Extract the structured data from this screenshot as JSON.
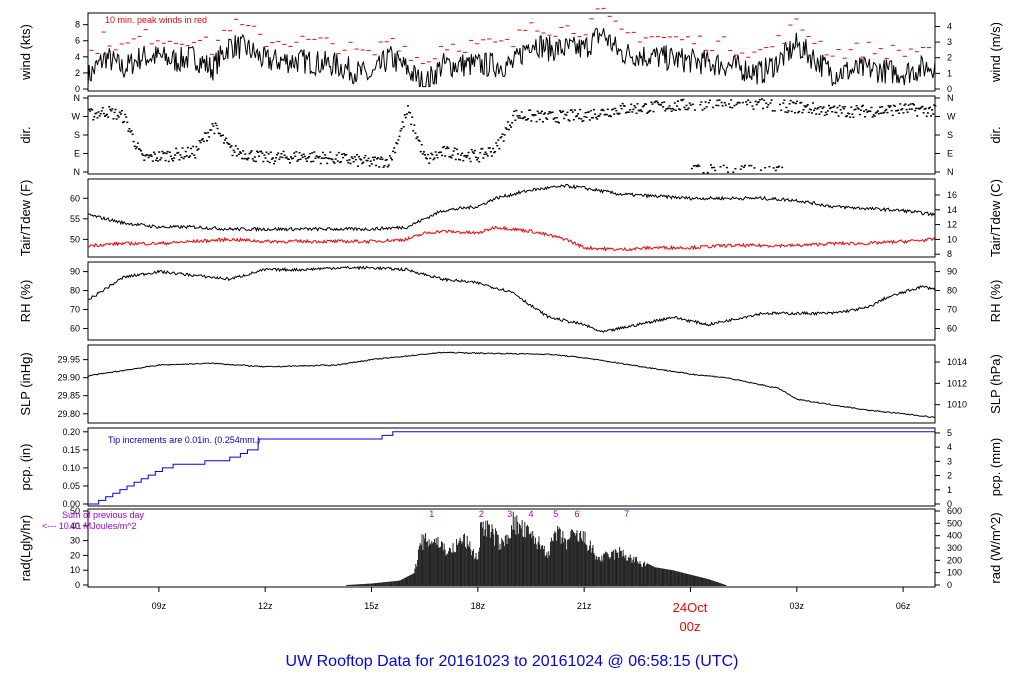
{
  "title": "UW Rooftop Data for 20161023  to  20161024 @ 06:58:15  (UTC)",
  "colors": {
    "title": "#0000ff",
    "peak": "#ff0000",
    "dew": "#ff0000",
    "pcp": "#0000ff",
    "annot": "#a000e0",
    "date": "#ff0000"
  },
  "x_axis": {
    "range_hours": [
      7.0,
      30.9
    ],
    "ticks": [
      {
        "h": 9,
        "label": "09z"
      },
      {
        "h": 12,
        "label": "12z"
      },
      {
        "h": 15,
        "label": "15z"
      },
      {
        "h": 18,
        "label": "18z"
      },
      {
        "h": 21,
        "label": "21z"
      },
      {
        "h": 27,
        "label": "03z"
      },
      {
        "h": 30,
        "label": "06z"
      }
    ],
    "date_label": "24Oct",
    "date_hour_label": "00z"
  },
  "chart_data": [
    {
      "type": "line",
      "name": "wind",
      "ylabel": "wind (kts)",
      "ylabel_right": "wind (m/s)",
      "ylim": [
        0,
        9.2
      ],
      "yticks": [
        0,
        2,
        4,
        6,
        8
      ],
      "yticks_right": [
        0,
        1,
        2,
        3,
        4,
        5
      ],
      "annotation": "10 min. peak winds in red",
      "hours": [
        7,
        7.5,
        8,
        8.5,
        9,
        9.5,
        10,
        10.5,
        11,
        11.5,
        12,
        13,
        14,
        15,
        15.5,
        16,
        16.5,
        17,
        18,
        19,
        19.5,
        20,
        21,
        21.5,
        22,
        23,
        24,
        25,
        26,
        26.5,
        27,
        28,
        29,
        30,
        30.9
      ],
      "values": [
        1.5,
        4,
        2.5,
        4,
        4,
        3.5,
        4,
        2.5,
        5.5,
        5,
        3.5,
        3.5,
        3,
        1.5,
        4,
        2.5,
        0.5,
        3,
        3,
        3,
        6,
        5,
        5,
        7,
        4.5,
        4,
        3.5,
        3,
        2,
        3.5,
        5.5,
        2,
        2.5,
        2,
        3
      ]
    },
    {
      "type": "scatter",
      "name": "direction",
      "ylabel": "dir.",
      "ylim": [
        0,
        360
      ],
      "ytick_labels": [
        "N",
        "E",
        "S",
        "W",
        "N"
      ],
      "hours": [
        7,
        7.5,
        8,
        8.5,
        9,
        10,
        10.5,
        11,
        12,
        13,
        14,
        15,
        15.5,
        16,
        16.5,
        17,
        18,
        18.5,
        19,
        20,
        21,
        22,
        23,
        24,
        25,
        26,
        27,
        28,
        29,
        30,
        30.9
      ],
      "values": [
        280,
        300,
        270,
        70,
        80,
        100,
        230,
        110,
        70,
        80,
        70,
        50,
        60,
        300,
        60,
        100,
        80,
        120,
        280,
        270,
        280,
        310,
        320,
        330,
        335,
        330,
        320,
        300,
        300,
        310,
        300
      ]
    },
    {
      "type": "line",
      "name": "temperature",
      "ylabel": "Tair/Tdew (F)",
      "ylabel_right": "Tair/Tdew (C)",
      "ylim": [
        46.2,
        64.2
      ],
      "yticks": [
        50,
        55,
        60
      ],
      "yticks_right": [
        8,
        10,
        12,
        14,
        16
      ],
      "hours": [
        7,
        8,
        9,
        10,
        11,
        12,
        13,
        14,
        15,
        16,
        16.5,
        17,
        18,
        18.5,
        19.5,
        20.5,
        21,
        22,
        23,
        24,
        25,
        26,
        27,
        28,
        29,
        30,
        30.9
      ],
      "tair": [
        56,
        54,
        53,
        53,
        52.5,
        52.5,
        52.5,
        52.5,
        52.5,
        53,
        55,
        57,
        58,
        60,
        62,
        63,
        62.5,
        61,
        60.5,
        60,
        60,
        60,
        59.5,
        58,
        57.5,
        57,
        56
      ],
      "tdew": [
        48.5,
        49,
        49,
        49.5,
        50,
        49.5,
        49.5,
        49.5,
        49.5,
        50,
        51.5,
        52,
        51.5,
        53,
        52,
        50,
        48,
        47.5,
        48,
        48,
        48.5,
        48.5,
        48.5,
        49,
        49,
        49.5,
        50
      ]
    },
    {
      "type": "line",
      "name": "rh",
      "ylabel": "RH (%)",
      "ylim": [
        55,
        94
      ],
      "yticks": [
        60,
        70,
        80,
        90
      ],
      "yticks_right": [
        60,
        70,
        80,
        90
      ],
      "hours": [
        7,
        8,
        9,
        10,
        11,
        12,
        13,
        14,
        15,
        16,
        17,
        18,
        19,
        19.5,
        20,
        21,
        21.5,
        22,
        22.5,
        23.5,
        24.5,
        25,
        26,
        27,
        28,
        29,
        29.5,
        30,
        30.5,
        30.9
      ],
      "values": [
        75,
        87,
        90,
        88,
        86,
        91,
        91,
        92,
        92,
        91,
        86,
        84,
        79,
        72,
        66,
        62,
        58,
        60,
        62,
        66,
        62,
        64,
        68,
        68,
        68,
        71,
        76,
        79,
        82,
        81
      ]
    },
    {
      "type": "line",
      "name": "pressure",
      "ylabel": "SLP (inHg)",
      "ylabel_right": "SLP (hPa)",
      "ylim": [
        29.78,
        29.985
      ],
      "yticks": [
        29.8,
        29.85,
        29.9,
        29.95
      ],
      "yticks_right": [
        1010,
        1012,
        1014
      ],
      "hours": [
        7,
        8,
        9,
        10.5,
        12,
        14,
        15,
        16,
        17,
        18,
        20,
        21,
        22,
        23,
        24,
        25,
        26,
        26.5,
        27,
        28,
        29,
        30,
        30.9
      ],
      "values": [
        29.905,
        29.92,
        29.935,
        29.94,
        29.93,
        29.935,
        29.95,
        29.96,
        29.97,
        29.968,
        29.965,
        29.955,
        29.94,
        29.925,
        29.91,
        29.9,
        29.88,
        29.87,
        29.84,
        29.825,
        29.81,
        29.8,
        29.79
      ]
    },
    {
      "type": "line",
      "name": "precipitation",
      "ylabel": "pcp. (in)",
      "ylabel_right": "pcp. (mm)",
      "ylim": [
        0,
        0.205
      ],
      "yticks": [
        0,
        0.05,
        0.1,
        0.15,
        0.2
      ],
      "yticks_right": [
        0,
        1,
        2,
        3,
        4,
        5
      ],
      "annotation": "Tip increments are 0.01in. (0.254mm.)",
      "hours": [
        7,
        7.3,
        7.5,
        7.7,
        7.9,
        8.1,
        8.3,
        8.5,
        8.7,
        8.9,
        9.1,
        9.4,
        10.3,
        11.0,
        11.3,
        11.5,
        11.8,
        15.3,
        15.6,
        30.9
      ],
      "values": [
        0,
        0.01,
        0.02,
        0.03,
        0.04,
        0.05,
        0.06,
        0.07,
        0.08,
        0.09,
        0.1,
        0.11,
        0.12,
        0.13,
        0.14,
        0.15,
        0.18,
        0.19,
        0.2,
        0.2
      ]
    },
    {
      "type": "area",
      "name": "radiation",
      "ylabel": "rad(Lgly/hr)",
      "ylabel_right": "rad (W/m^2)",
      "ylim": [
        0,
        50
      ],
      "yticks": [
        0,
        10,
        20,
        30,
        40,
        50
      ],
      "yticks_right": [
        0,
        100,
        200,
        300,
        400,
        500,
        600
      ],
      "annotation_1": "Sum of previous day",
      "annotation_2": "<--- 10.01 MJoules/m^2",
      "markers": [
        {
          "h": 16.7,
          "label": "1"
        },
        {
          "h": 18.1,
          "label": "2"
        },
        {
          "h": 18.9,
          "label": "3"
        },
        {
          "h": 19.5,
          "label": "4"
        },
        {
          "h": 20.2,
          "label": "5"
        },
        {
          "h": 20.8,
          "label": "6"
        },
        {
          "h": 22.2,
          "label": "7"
        }
      ],
      "hours": [
        7,
        14.3,
        15,
        15.8,
        16.2,
        16.4,
        16.8,
        17,
        17.2,
        17.6,
        18,
        18.1,
        18.4,
        18.7,
        19,
        19.3,
        19.6,
        20,
        20.2,
        20.5,
        20.7,
        21,
        21.4,
        22,
        22.5,
        23,
        23.5,
        24,
        24.5,
        25,
        30.9
      ],
      "values": [
        0,
        0,
        1,
        3,
        8,
        33,
        35,
        30,
        25,
        36,
        20,
        48,
        40,
        30,
        48,
        42,
        35,
        25,
        40,
        33,
        38,
        36,
        20,
        25,
        18,
        12,
        10,
        7,
        4,
        0,
        0
      ]
    }
  ]
}
